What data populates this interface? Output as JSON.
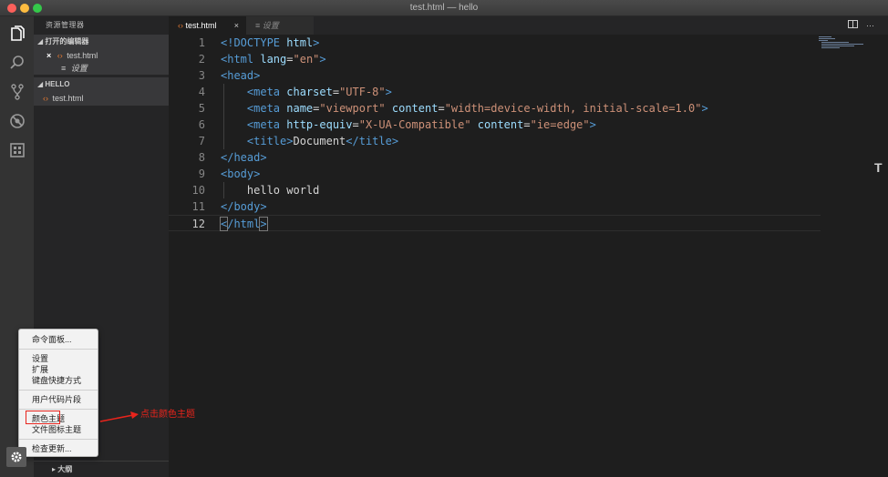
{
  "window": {
    "title": "test.html — hello"
  },
  "sidebar": {
    "title": "资源管理器",
    "open_editors": {
      "label": "打开的编辑器",
      "items": [
        {
          "close": "×",
          "icon": "‹›",
          "label": "test.html"
        },
        {
          "icon": "≡",
          "label": "设置"
        }
      ]
    },
    "folder": {
      "label": "HELLO",
      "items": [
        {
          "icon": "‹›",
          "label": "test.html"
        }
      ]
    },
    "outline": {
      "label": "大纲"
    }
  },
  "tabs": [
    {
      "icon": "‹›",
      "label": "test.html",
      "close": "×"
    },
    {
      "icon": "≡",
      "label": "设置"
    }
  ],
  "editor": {
    "current_line": 12,
    "lines": [
      {
        "n": "1",
        "parts": [
          {
            "t": "<!DOCTYPE ",
            "c": "tag"
          },
          {
            "t": "html",
            "c": "attr"
          },
          {
            "t": ">",
            "c": "tag"
          }
        ]
      },
      {
        "n": "2",
        "parts": [
          {
            "t": "<html ",
            "c": "tag"
          },
          {
            "t": "lang",
            "c": "attr"
          },
          {
            "t": "=",
            "c": "plain"
          },
          {
            "t": "\"en\"",
            "c": "str"
          },
          {
            "t": ">",
            "c": "tag"
          }
        ]
      },
      {
        "n": "3",
        "parts": [
          {
            "t": "<head>",
            "c": "tag"
          }
        ]
      },
      {
        "n": "4",
        "parts": [
          {
            "t": "    <meta ",
            "c": "tag"
          },
          {
            "t": "charset",
            "c": "attr"
          },
          {
            "t": "=",
            "c": "plain"
          },
          {
            "t": "\"UTF-8\"",
            "c": "str"
          },
          {
            "t": ">",
            "c": "tag"
          }
        ]
      },
      {
        "n": "5",
        "parts": [
          {
            "t": "    <meta ",
            "c": "tag"
          },
          {
            "t": "name",
            "c": "attr"
          },
          {
            "t": "=",
            "c": "plain"
          },
          {
            "t": "\"viewport\" ",
            "c": "str"
          },
          {
            "t": "content",
            "c": "attr"
          },
          {
            "t": "=",
            "c": "plain"
          },
          {
            "t": "\"width=device-width, initial-scale=1.0\"",
            "c": "str"
          },
          {
            "t": ">",
            "c": "tag"
          }
        ]
      },
      {
        "n": "6",
        "parts": [
          {
            "t": "    <meta ",
            "c": "tag"
          },
          {
            "t": "http-equiv",
            "c": "attr"
          },
          {
            "t": "=",
            "c": "plain"
          },
          {
            "t": "\"X-UA-Compatible\" ",
            "c": "str"
          },
          {
            "t": "content",
            "c": "attr"
          },
          {
            "t": "=",
            "c": "plain"
          },
          {
            "t": "\"ie=edge\"",
            "c": "str"
          },
          {
            "t": ">",
            "c": "tag"
          }
        ]
      },
      {
        "n": "7",
        "parts": [
          {
            "t": "    <title>",
            "c": "tag"
          },
          {
            "t": "Document",
            "c": "plain"
          },
          {
            "t": "</title>",
            "c": "tag"
          }
        ]
      },
      {
        "n": "8",
        "parts": [
          {
            "t": "</head>",
            "c": "tag"
          }
        ]
      },
      {
        "n": "9",
        "parts": [
          {
            "t": "<body>",
            "c": "tag"
          }
        ]
      },
      {
        "n": "10",
        "parts": [
          {
            "t": "    hello world",
            "c": "plain"
          }
        ]
      },
      {
        "n": "11",
        "parts": [
          {
            "t": "</body>",
            "c": "tag"
          }
        ]
      },
      {
        "n": "12",
        "parts": [
          {
            "t": "<",
            "c": "tag bracket"
          },
          {
            "t": "/html",
            "c": "tag"
          },
          {
            "t": ">",
            "c": "tag bracket"
          }
        ]
      }
    ]
  },
  "context_menu": {
    "items": [
      {
        "label": "命令面板..."
      },
      {
        "label": "设置"
      },
      {
        "label": "扩展"
      },
      {
        "label": "键盘快捷方式"
      },
      {
        "label": "用户代码片段"
      },
      {
        "label": "颜色主题"
      },
      {
        "label": "文件图标主题"
      },
      {
        "label": "检查更新..."
      }
    ]
  },
  "annotation": {
    "text": "点击颜色主题",
    "color": "#e8241c"
  },
  "side_glyph": "T",
  "colors": {
    "tag": "#569cd6",
    "attr": "#9cdcfe",
    "string": "#ce9178",
    "file_icon": "#e37933"
  }
}
